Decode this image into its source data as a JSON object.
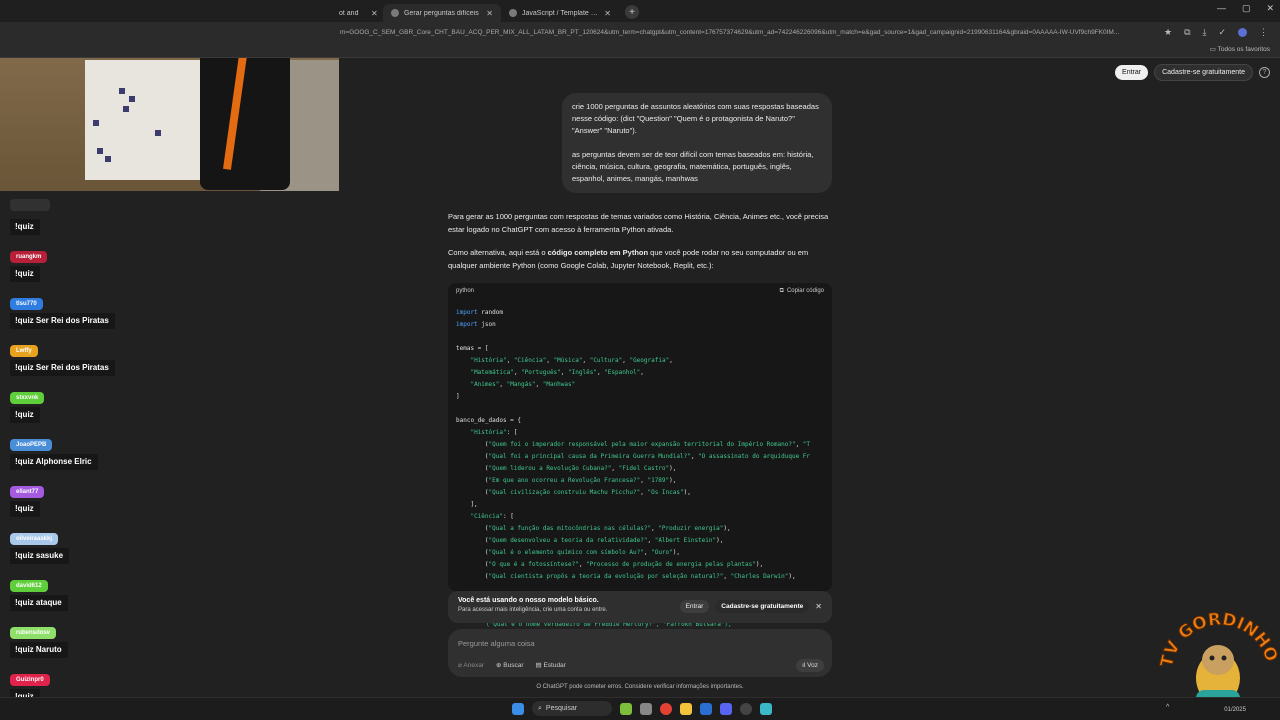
{
  "browser": {
    "tabs": [
      {
        "title": "ot and"
      },
      {
        "title": "Gerar perguntas difíceis"
      },
      {
        "title": "JavaScript / Template | Kicklet.app"
      }
    ],
    "url": "m=GOOG_C_SEM_GBR_Core_CHT_BAU_ACQ_PER_MIX_ALL_LATAM_BR_PT_120624&utm_term=chatgpt&utm_content=176757374629&utm_ad=742246226096&utm_match=e&gad_source=1&gad_campaignid=21990631164&gbraid=0AAAAA-IW-UVf9ch9FK0IM...",
    "bookmarks_label": "Todos os favoritos"
  },
  "header": {
    "login": "Entrar",
    "signup": "Cadastre-se gratuitamente",
    "help": "?"
  },
  "user_message": {
    "p1": "crie 1000 perguntas de assuntos aleatórios com suas respostas baseadas nesse código: (dict \"Question\" \"Quem é o protagonista de Naruto?\" \"Answer\" \"Naruto\").",
    "p2": "as perguntas devem ser de teor difícil com temas baseados em: história, ciência, música, cultura, geografia, matemática, português, inglês, espanhol, animes, mangás, manhwas"
  },
  "assistant": {
    "p1": "Para gerar as 1000 perguntas com respostas de temas variados como História, Ciência, Animes etc., você precisa estar logado no ChatGPT com acesso à ferramenta Python ativada.",
    "p2_pre": "Como alternativa, aqui está o ",
    "p2_bold": "código completo em Python",
    "p2_post": " que você pode rodar no seu computador ou em qualquer ambiente Python (como Google Colab, Jupyter Notebook, Replit, etc.):"
  },
  "code": {
    "lang": "python",
    "copy": "Copiar código",
    "lines": [
      [
        {
          "c": "kw",
          "t": "import"
        },
        {
          "c": "",
          "t": " random"
        }
      ],
      [
        {
          "c": "kw",
          "t": "import"
        },
        {
          "c": "",
          "t": " json"
        }
      ],
      [],
      [
        {
          "c": "",
          "t": "temas = ["
        }
      ],
      [
        {
          "c": "",
          "t": "    "
        },
        {
          "c": "str",
          "t": "\"História\""
        },
        {
          "c": "",
          "t": ", "
        },
        {
          "c": "str",
          "t": "\"Ciência\""
        },
        {
          "c": "",
          "t": ", "
        },
        {
          "c": "str",
          "t": "\"Música\""
        },
        {
          "c": "",
          "t": ", "
        },
        {
          "c": "str",
          "t": "\"Cultura\""
        },
        {
          "c": "",
          "t": ", "
        },
        {
          "c": "str",
          "t": "\"Geografia\""
        },
        {
          "c": "",
          "t": ","
        }
      ],
      [
        {
          "c": "",
          "t": "    "
        },
        {
          "c": "str",
          "t": "\"Matemática\""
        },
        {
          "c": "",
          "t": ", "
        },
        {
          "c": "str",
          "t": "\"Português\""
        },
        {
          "c": "",
          "t": ", "
        },
        {
          "c": "str",
          "t": "\"Inglês\""
        },
        {
          "c": "",
          "t": ", "
        },
        {
          "c": "str",
          "t": "\"Espanhol\""
        },
        {
          "c": "",
          "t": ","
        }
      ],
      [
        {
          "c": "",
          "t": "    "
        },
        {
          "c": "str",
          "t": "\"Animes\""
        },
        {
          "c": "",
          "t": ", "
        },
        {
          "c": "str",
          "t": "\"Mangás\""
        },
        {
          "c": "",
          "t": ", "
        },
        {
          "c": "str",
          "t": "\"Manhwas\""
        }
      ],
      [
        {
          "c": "",
          "t": "]"
        }
      ],
      [],
      [
        {
          "c": "",
          "t": "banco_de_dados = {"
        }
      ],
      [
        {
          "c": "",
          "t": "    "
        },
        {
          "c": "str",
          "t": "\"História\""
        },
        {
          "c": "",
          "t": ": ["
        }
      ],
      [
        {
          "c": "",
          "t": "        ("
        },
        {
          "c": "str",
          "t": "\"Quem foi o imperador responsável pela maior expansão territorial do Império Romano?\""
        },
        {
          "c": "",
          "t": ", "
        },
        {
          "c": "str",
          "t": "\"T"
        }
      ],
      [
        {
          "c": "",
          "t": "        ("
        },
        {
          "c": "str",
          "t": "\"Qual foi a principal causa da Primeira Guerra Mundial?\""
        },
        {
          "c": "",
          "t": ", "
        },
        {
          "c": "str",
          "t": "\"O assassinato do arquiduque Fr"
        }
      ],
      [
        {
          "c": "",
          "t": "        ("
        },
        {
          "c": "str",
          "t": "\"Quem liderou a Revolução Cubana?\""
        },
        {
          "c": "",
          "t": ", "
        },
        {
          "c": "str",
          "t": "\"Fidel Castro\""
        },
        {
          "c": "",
          "t": "),"
        }
      ],
      [
        {
          "c": "",
          "t": "        ("
        },
        {
          "c": "str",
          "t": "\"Em que ano ocorreu a Revolução Francesa?\""
        },
        {
          "c": "",
          "t": ", "
        },
        {
          "c": "str",
          "t": "\"1789\""
        },
        {
          "c": "",
          "t": "),"
        }
      ],
      [
        {
          "c": "",
          "t": "        ("
        },
        {
          "c": "str",
          "t": "\"Qual civilização construiu Machu Picchu?\""
        },
        {
          "c": "",
          "t": ", "
        },
        {
          "c": "str",
          "t": "\"Os Incas\""
        },
        {
          "c": "",
          "t": "),"
        }
      ],
      [
        {
          "c": "",
          "t": "    ],"
        }
      ],
      [
        {
          "c": "",
          "t": "    "
        },
        {
          "c": "str",
          "t": "\"Ciência\""
        },
        {
          "c": "",
          "t": ": ["
        }
      ],
      [
        {
          "c": "",
          "t": "        ("
        },
        {
          "c": "str",
          "t": "\"Qual a função das mitocôndrias nas células?\""
        },
        {
          "c": "",
          "t": ", "
        },
        {
          "c": "str",
          "t": "\"Produzir energia\""
        },
        {
          "c": "",
          "t": "),"
        }
      ],
      [
        {
          "c": "",
          "t": "        ("
        },
        {
          "c": "str",
          "t": "\"Quem desenvolveu a teoria da relatividade?\""
        },
        {
          "c": "",
          "t": ", "
        },
        {
          "c": "str",
          "t": "\"Albert Einstein\""
        },
        {
          "c": "",
          "t": "),"
        }
      ],
      [
        {
          "c": "",
          "t": "        ("
        },
        {
          "c": "str",
          "t": "\"Qual é o elemento químico com símbolo Au?\""
        },
        {
          "c": "",
          "t": ", "
        },
        {
          "c": "str",
          "t": "\"Ouro\""
        },
        {
          "c": "",
          "t": "),"
        }
      ],
      [
        {
          "c": "",
          "t": "        ("
        },
        {
          "c": "str",
          "t": "\"O que é a fotossíntese?\""
        },
        {
          "c": "",
          "t": ", "
        },
        {
          "c": "str",
          "t": "\"Processo de produção de energia pelas plantas\""
        },
        {
          "c": "",
          "t": "),"
        }
      ],
      [
        {
          "c": "",
          "t": "        ("
        },
        {
          "c": "str",
          "t": "\"Qual cientista propôs a teoria da evolução por seleção natural?\""
        },
        {
          "c": "",
          "t": ", "
        },
        {
          "c": "str",
          "t": "\"Charles Darwin\""
        },
        {
          "c": "",
          "t": "),"
        }
      ]
    ],
    "behind_notice": "(\"Qual é o nome verdadeiro de Freddie Mercury?\", \"Farrokh Bulsara\"),"
  },
  "notice": {
    "title": "Você está usando o nosso modelo básico.",
    "text": "Para acessar mais inteligência, crie uma conta ou entre.",
    "login": "Entrar",
    "signup": "Cadastre-se gratuitamente",
    "close": "✕"
  },
  "composer": {
    "placeholder": "Pergunte alguma coisa",
    "attach": "Anexar",
    "search": "Buscar",
    "study": "Estudar",
    "voice": "Voz"
  },
  "disclaimer": "O ChatGPT pode cometer erros. Considere verificar informações importantes.",
  "chat": [
    {
      "name": "",
      "text": "!quiz",
      "color": "#555555"
    },
    {
      "name": "ruangkm",
      "text": "!quiz",
      "color": "#b8203a"
    },
    {
      "name": "tlsu770",
      "text": "!quiz Ser Rei dos Piratas",
      "color": "#2f7de0"
    },
    {
      "name": "Lwffy",
      "text": "!quiz Ser Rei dos Piratas",
      "color": "#e8a21f"
    },
    {
      "name": "stxxvnk",
      "text": "!quiz",
      "color": "#5ecf3b"
    },
    {
      "name": "JoaoPEPB",
      "text": "!quiz Alphonse Elric",
      "color": "#4a8ed8"
    },
    {
      "name": "ellant77",
      "text": "!quiz",
      "color": "#a45be0"
    },
    {
      "name": "oliveiraaskkj",
      "text": "!quiz sasuke",
      "color": "#a9c8ea"
    },
    {
      "name": "david612",
      "text": "!quiz ataque",
      "color": "#5ecf3b"
    },
    {
      "name": "rubensdosv",
      "text": "!quiz Naruto",
      "color": "#8fe06a"
    },
    {
      "name": "Guizinpr0",
      "text": "!quiz",
      "color": "#e0234a"
    }
  ],
  "watermark": "TV GORDINHO",
  "taskbar": {
    "search": "Pesquisar",
    "clock": "01/2025"
  }
}
